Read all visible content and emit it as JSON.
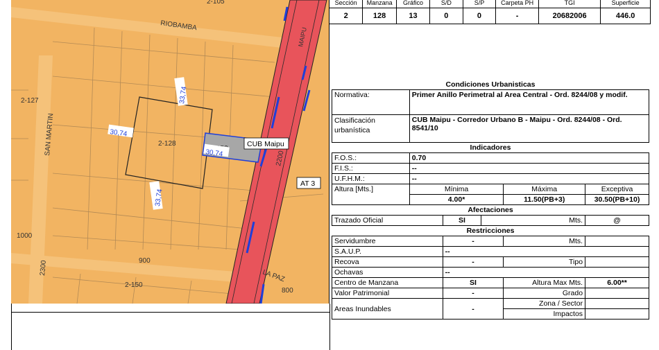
{
  "map": {
    "streets": {
      "riobamba": "RIOBAMBA",
      "maipu": "MAIPU",
      "san_martin": "SAN MARTIN",
      "la_paz": "LA PAZ"
    },
    "blocks": [
      "2-105",
      "2-127",
      "2-128",
      "2-150"
    ],
    "numbers": {
      "n2200": "2200",
      "n1000": "1000",
      "n2300": "2300",
      "n900": "900",
      "n800": "800"
    },
    "dims": {
      "d1": "33,74",
      "d2": "30,74",
      "d3": "30,74",
      "d4": "33,74"
    },
    "lot_label": "152",
    "cub_label": "CUB Maipu",
    "at_label": "AT 3",
    "colors": {
      "bg": "#F2B462",
      "road": "#E8545B",
      "lot": "#9E9E9E",
      "blue": "#1F3FD9"
    }
  },
  "catastro": {
    "headers": [
      "Sección",
      "Manzana",
      "Gráfico",
      "S/D",
      "S/P",
      "Carpeta PH",
      "TGI",
      "Superficie"
    ],
    "values": [
      "2",
      "128",
      "13",
      "0",
      "0",
      "-",
      "20682006",
      "446.0"
    ]
  },
  "condiciones": {
    "title": "Condiciones Urbanisticas",
    "normativa_label": "Normativa:",
    "normativa_value": "Primer Anillo Perimetral al Area Central - Ord. 8244/08 y modif.",
    "clasif_label1": "Clasificación",
    "clasif_label2": "urbanística",
    "clasif_value": "CUB Maipu - Corredor Urbano B - Maipu - Ord. 8244/08 - Ord. 8541/10"
  },
  "indicadores": {
    "title": "Indicadores",
    "fos_label": "F.O.S.:",
    "fos_value": "0.70",
    "fis_label": "F.I.S.:",
    "fis_value": "--",
    "ufhm_label": "U.F.H.M.:",
    "ufhm_value": "--",
    "altura_label": "Altura [Mts.]",
    "minima_label": "Mínima",
    "maxima_label": "Máxima",
    "excep_label": "Exceptiva",
    "minima": "4.00*",
    "maxima": "11.50(PB+3)",
    "excep": "30.50(PB+10)"
  },
  "afectaciones": {
    "title": "Afectaciones",
    "trazado_label": "Trazado Oficial",
    "trazado_value": "SI",
    "mts_label": "Mts.",
    "mts_value": "@"
  },
  "restricciones": {
    "title": "Restricciones",
    "servidumbre_label": "Servidumbre",
    "servidumbre_value": "-",
    "serv_mts_label": "Mts.",
    "saup_label": "S.A.U.P.",
    "saup_value": "--",
    "recova_label": "Recova",
    "recova_value": "-",
    "tipo_label": "Tipo",
    "ochavas_label": "Ochavas",
    "ochavas_value": "--",
    "centro_label": "Centro de Manzana",
    "centro_value": "SI",
    "altmax_label": "Altura Max Mts.",
    "altmax_value": "6.00**",
    "valor_label": "Valor Patrimonial",
    "valor_value": "-",
    "grado_label": "Grado",
    "areas_label": "Areas Inundables",
    "areas_value": "-",
    "zona_label": "Zona / Sector",
    "impactos_label": "Impactos"
  }
}
